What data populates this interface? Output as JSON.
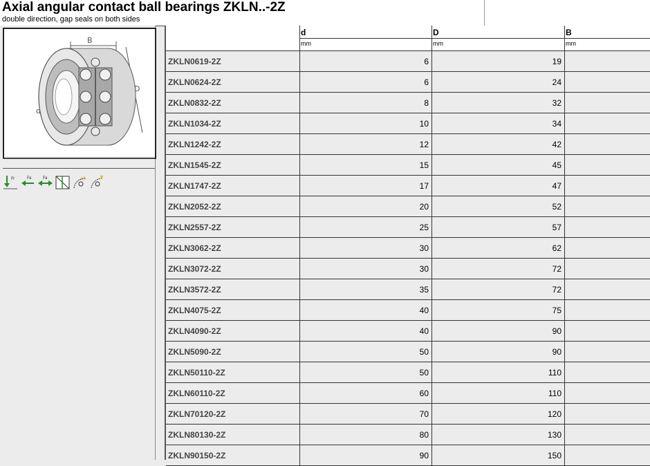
{
  "header": {
    "title": "Axial angular contact ball bearings ZKLN..-2Z",
    "subtitle": "double direction, gap seals on both sides"
  },
  "drawing": {
    "label_B": "B",
    "label_D": "D",
    "label_d": "d"
  },
  "icons": [
    "radial-load-icon",
    "axial-load-left-icon",
    "axial-load-both-icon",
    "sealed-bearing-icon",
    "rotation-lubrication-icon",
    "rotation-speed-icon"
  ],
  "table": {
    "columns": [
      {
        "symbol": "",
        "unit": ""
      },
      {
        "symbol": "d",
        "unit": "mm"
      },
      {
        "symbol": "D",
        "unit": "mm"
      },
      {
        "symbol": "B",
        "unit": "mm"
      }
    ],
    "rows": [
      {
        "designation": "ZKLN0619-2Z",
        "d": "6",
        "D": "19",
        "B": ""
      },
      {
        "designation": "ZKLN0624-2Z",
        "d": "6",
        "D": "24",
        "B": ""
      },
      {
        "designation": "ZKLN0832-2Z",
        "d": "8",
        "D": "32",
        "B": ""
      },
      {
        "designation": "ZKLN1034-2Z",
        "d": "10",
        "D": "34",
        "B": ""
      },
      {
        "designation": "ZKLN1242-2Z",
        "d": "12",
        "D": "42",
        "B": ""
      },
      {
        "designation": "ZKLN1545-2Z",
        "d": "15",
        "D": "45",
        "B": ""
      },
      {
        "designation": "ZKLN1747-2Z",
        "d": "17",
        "D": "47",
        "B": ""
      },
      {
        "designation": "ZKLN2052-2Z",
        "d": "20",
        "D": "52",
        "B": ""
      },
      {
        "designation": "ZKLN2557-2Z",
        "d": "25",
        "D": "57",
        "B": ""
      },
      {
        "designation": "ZKLN3062-2Z",
        "d": "30",
        "D": "62",
        "B": ""
      },
      {
        "designation": "ZKLN3072-2Z",
        "d": "30",
        "D": "72",
        "B": ""
      },
      {
        "designation": "ZKLN3572-2Z",
        "d": "35",
        "D": "72",
        "B": ""
      },
      {
        "designation": "ZKLN4075-2Z",
        "d": "40",
        "D": "75",
        "B": ""
      },
      {
        "designation": "ZKLN4090-2Z",
        "d": "40",
        "D": "90",
        "B": ""
      },
      {
        "designation": "ZKLN5090-2Z",
        "d": "50",
        "D": "90",
        "B": ""
      },
      {
        "designation": "ZKLN50110-2Z",
        "d": "50",
        "D": "110",
        "B": ""
      },
      {
        "designation": "ZKLN60110-2Z",
        "d": "60",
        "D": "110",
        "B": ""
      },
      {
        "designation": "ZKLN70120-2Z",
        "d": "70",
        "D": "120",
        "B": ""
      },
      {
        "designation": "ZKLN80130-2Z",
        "d": "80",
        "D": "130",
        "B": ""
      },
      {
        "designation": "ZKLN90150-2Z",
        "d": "90",
        "D": "150",
        "B": ""
      }
    ]
  }
}
